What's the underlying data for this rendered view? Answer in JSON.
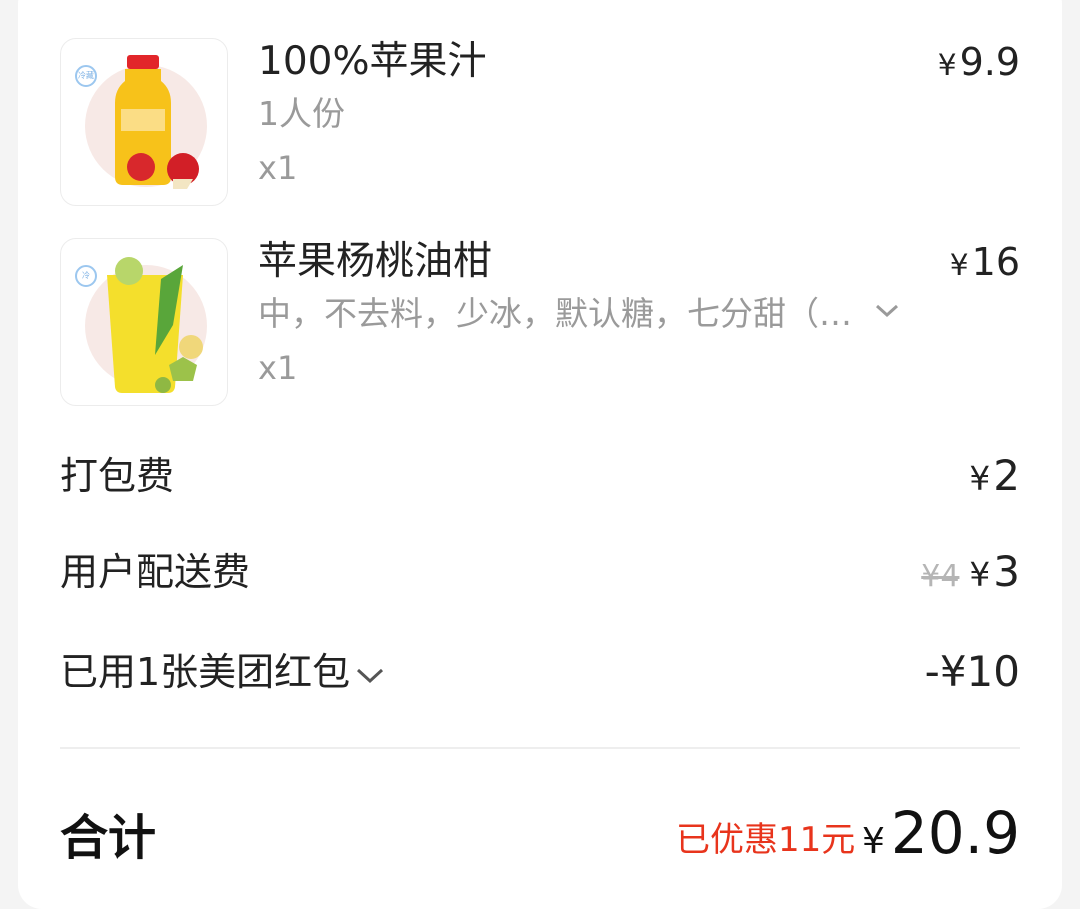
{
  "order_items": [
    {
      "name": "100%苹果汁",
      "spec": "1人份",
      "qty": "x1",
      "price_symbol": "¥",
      "price": "9.9",
      "image_icon": "apple-juice-bottle-image",
      "badge_text": "冷藏"
    },
    {
      "name": "苹果杨桃油柑",
      "spec": "中，不去料，少冰，默认糖，七分甜（…",
      "qty": "x1",
      "price_symbol": "¥",
      "price": "16",
      "image_icon": "fruit-tea-cup-image",
      "badge_text": "冷"
    }
  ],
  "fees": {
    "packaging_label": "打包费",
    "packaging_symbol": "¥",
    "packaging_value": "2",
    "delivery_label": "用户配送费",
    "delivery_original": "¥4",
    "delivery_symbol": "¥",
    "delivery_value": "3",
    "coupon_label": "已用1张美团红包",
    "coupon_value": "-¥10"
  },
  "summary": {
    "total_label": "合计",
    "saved_text": "已优惠11元",
    "total_symbol": "¥",
    "total_value": "20.9"
  },
  "colors": {
    "accent_red": "#f0471f",
    "text_primary": "#222222",
    "text_secondary": "#9a9a9a"
  }
}
